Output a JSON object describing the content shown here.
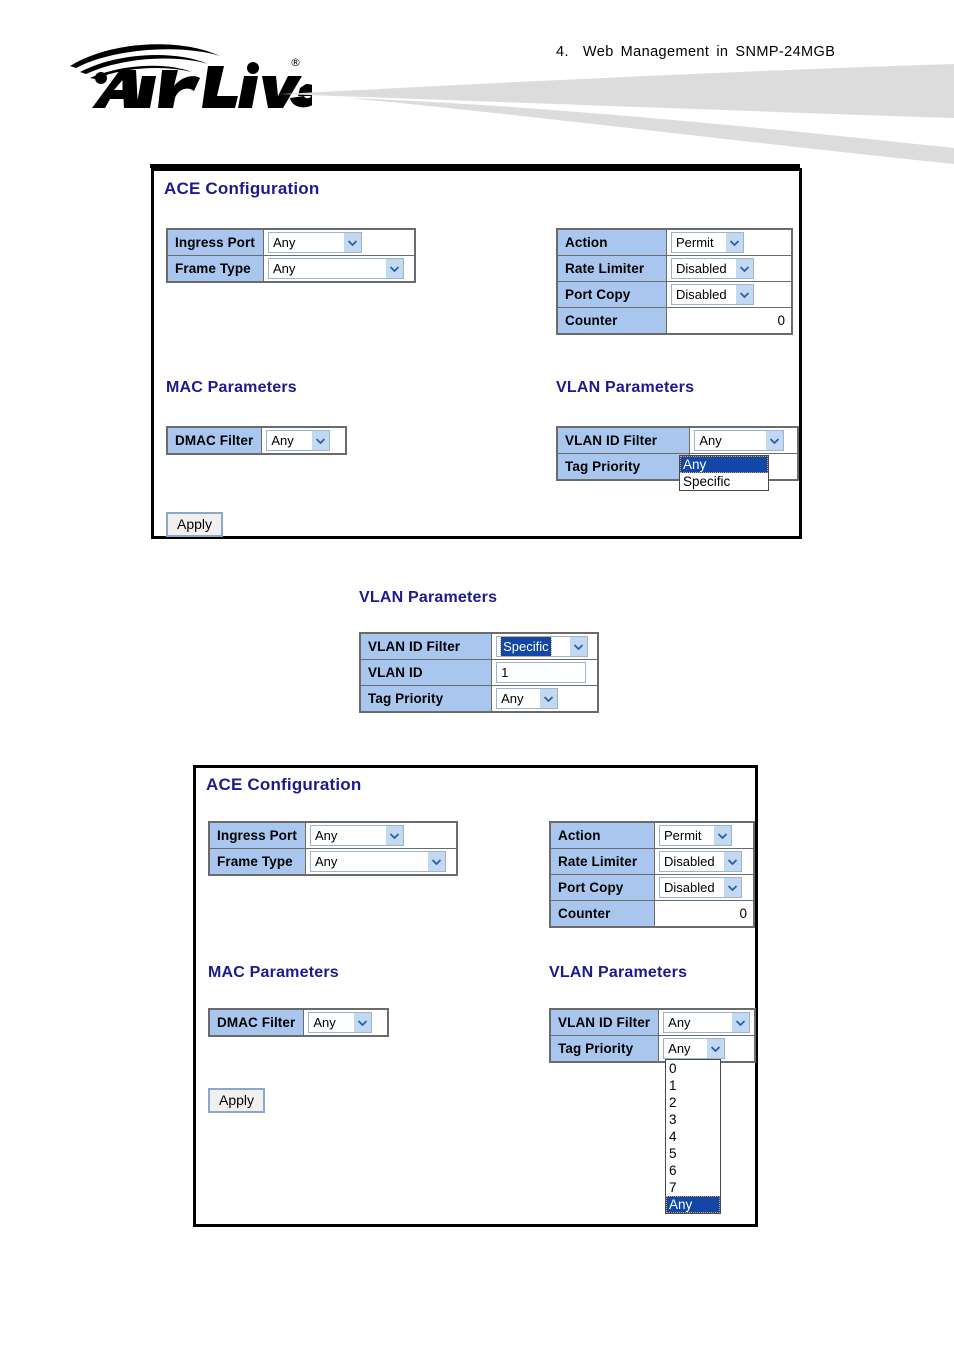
{
  "header": {
    "chapter_number": "4.",
    "title_words": [
      "Web",
      "Management",
      "in",
      "SNMP-24MGB"
    ],
    "logo_text": "Air Live",
    "logo_trademark": "®"
  },
  "colors": {
    "title_blue": "#1b1b8f",
    "row_header_blue": "#a8c6ee",
    "select_highlight": "#1247a8",
    "arrow_blue": "#c3d9f2",
    "panel_border": "#000000"
  },
  "panel1": {
    "title": "ACE Configuration",
    "left_table": {
      "rows": [
        {
          "label": "Ingress Port",
          "value": "Any",
          "control": "select"
        },
        {
          "label": "Frame Type",
          "value": "Any",
          "control": "select"
        }
      ]
    },
    "right_table": {
      "rows": [
        {
          "label": "Action",
          "value": "Permit",
          "control": "select"
        },
        {
          "label": "Rate Limiter",
          "value": "Disabled",
          "control": "select"
        },
        {
          "label": "Port Copy",
          "value": "Disabled",
          "control": "select"
        },
        {
          "label": "Counter",
          "value": "0",
          "control": "text-readonly"
        }
      ]
    },
    "mac_section": {
      "title": "MAC Parameters",
      "rows": [
        {
          "label": "DMAC Filter",
          "value": "Any",
          "control": "select"
        }
      ]
    },
    "vlan_section": {
      "title": "VLAN Parameters",
      "rows": [
        {
          "label": "VLAN ID Filter",
          "value": "Any",
          "control": "select"
        },
        {
          "label": "Tag Priority",
          "value": "",
          "control": "select"
        }
      ],
      "open_dropdown": {
        "belongs_to": "VLAN ID Filter",
        "options": [
          "Any",
          "Specific"
        ],
        "selected": "Any"
      }
    },
    "apply_label": "Apply"
  },
  "middle_vlan": {
    "title": "VLAN Parameters",
    "rows": [
      {
        "label": "VLAN ID Filter",
        "value": "Specific",
        "control": "select-selected"
      },
      {
        "label": "VLAN ID",
        "value": "1",
        "control": "textbox"
      },
      {
        "label": "Tag Priority",
        "value": "Any",
        "control": "select"
      }
    ]
  },
  "panel2": {
    "title": "ACE Configuration",
    "left_table": {
      "rows": [
        {
          "label": "Ingress Port",
          "value": "Any",
          "control": "select"
        },
        {
          "label": "Frame Type",
          "value": "Any",
          "control": "select"
        }
      ]
    },
    "right_table": {
      "rows": [
        {
          "label": "Action",
          "value": "Permit",
          "control": "select"
        },
        {
          "label": "Rate Limiter",
          "value": "Disabled",
          "control": "select"
        },
        {
          "label": "Port Copy",
          "value": "Disabled",
          "control": "select"
        },
        {
          "label": "Counter",
          "value": "0",
          "control": "text-readonly"
        }
      ]
    },
    "mac_section": {
      "title": "MAC Parameters",
      "rows": [
        {
          "label": "DMAC Filter",
          "value": "Any",
          "control": "select"
        }
      ]
    },
    "vlan_section": {
      "title": "VLAN Parameters",
      "rows": [
        {
          "label": "VLAN ID Filter",
          "value": "Any",
          "control": "select"
        },
        {
          "label": "Tag Priority",
          "value": "Any",
          "control": "select"
        }
      ],
      "open_dropdown": {
        "belongs_to": "Tag Priority",
        "options": [
          "0",
          "1",
          "2",
          "3",
          "4",
          "5",
          "6",
          "7",
          "Any"
        ],
        "selected": "Any"
      }
    },
    "apply_label": "Apply"
  }
}
